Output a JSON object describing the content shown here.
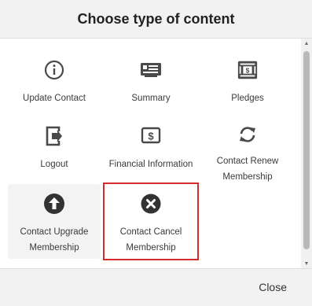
{
  "dialog": {
    "title": "Choose type of content",
    "close_label": "Close"
  },
  "tiles": [
    {
      "label": "Update Contact",
      "icon": "info-circle-icon"
    },
    {
      "label": "Summary",
      "icon": "id-card-icon"
    },
    {
      "label": "Pledges",
      "icon": "cash-stack-icon"
    },
    {
      "label": "Logout",
      "icon": "logout-door-icon"
    },
    {
      "label": "Financial Information",
      "icon": "dollar-card-icon"
    },
    {
      "label": "Contact Renew Membership",
      "icon": "refresh-icon"
    },
    {
      "label": "Contact Upgrade Membership",
      "icon": "arrow-up-circle-icon"
    },
    {
      "label": "Contact Cancel Membership",
      "icon": "x-circle-icon"
    }
  ],
  "colors": {
    "highlight_border": "#d32a2a",
    "icon": "#4a4a4a"
  }
}
